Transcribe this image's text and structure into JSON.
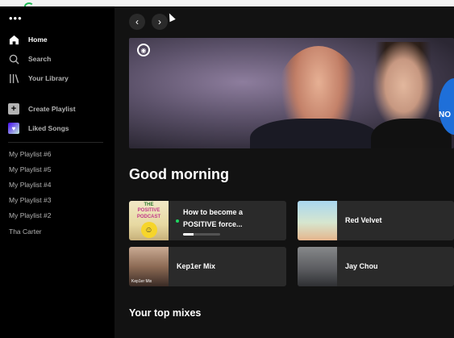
{
  "sidebar": {
    "menu_icon": "more-dots-icon",
    "nav": [
      {
        "label": "Home",
        "icon": "home-icon"
      },
      {
        "label": "Search",
        "icon": "search-icon"
      },
      {
        "label": "Your Library",
        "icon": "library-icon"
      }
    ],
    "actions": [
      {
        "label": "Create Playlist",
        "icon": "plus-icon"
      },
      {
        "label": "Liked Songs",
        "icon": "heart-icon"
      }
    ],
    "playlists": [
      "My Playlist #6",
      "My Playlist #5",
      "My Playlist #4",
      "My Playlist #3",
      "My Playlist #2",
      "Tha Carter"
    ]
  },
  "header": {
    "back_glyph": "‹",
    "forward_glyph": "›"
  },
  "banner": {
    "podcast_badge_glyph": "◉",
    "text": "NO",
    "accent": "#1e6fd9"
  },
  "main": {
    "greeting": "Good morning",
    "cards": [
      {
        "title_line1": "How to become a",
        "title_line2": "POSITIVE force...",
        "thumb_line1": "THE",
        "thumb_line2": "POSITIVE",
        "thumb_line3": "PODCAST",
        "progress": 0.28
      },
      {
        "title": "Red Velvet"
      },
      {
        "title": "Kep1er Mix",
        "thumb_label": "Kep1er Mix"
      },
      {
        "title": "Jay Chou"
      }
    ],
    "section_title": "Your top mixes"
  },
  "colors": {
    "spotify_green": "#1ed760",
    "sidebar_bg": "#000000",
    "main_bg": "#121212",
    "card_bg": "#2a2a2a"
  }
}
